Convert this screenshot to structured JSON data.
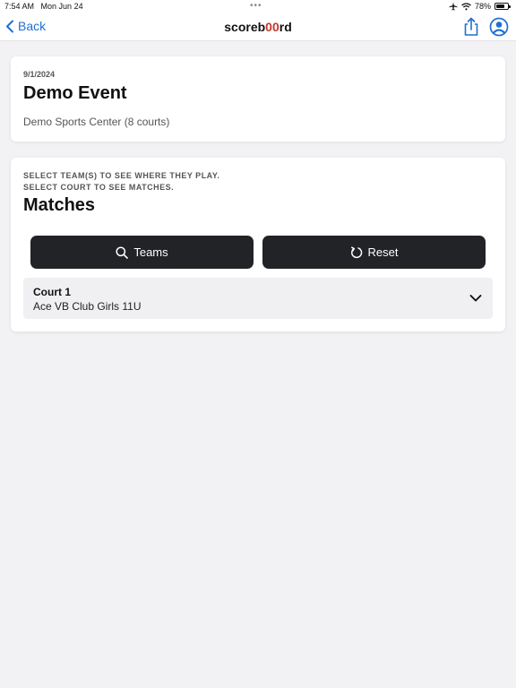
{
  "status_bar": {
    "time": "7:54 AM",
    "date": "Mon Jun 24",
    "battery": "78%",
    "battery_level": 0.78,
    "more_dots": "•••"
  },
  "nav": {
    "back_label": "Back",
    "title_prefix": "scoreb",
    "title_accent": "00",
    "title_suffix": "rd",
    "accent_color": "#c0392b",
    "link_color": "#1f6fd1"
  },
  "event": {
    "date": "9/1/2024",
    "title": "Demo Event",
    "venue": "Demo Sports Center (8 courts)"
  },
  "matches": {
    "instruction_line1": "SELECT TEAM(S) TO SEE WHERE THEY PLAY.",
    "instruction_line2": "SELECT COURT TO SEE MATCHES.",
    "title": "Matches",
    "teams_button": "Teams",
    "reset_button": "Reset",
    "courts": [
      {
        "name": "Court 1",
        "team": "Ace VB Club Girls 11U"
      }
    ]
  },
  "icons": {
    "back": "chevron-left-icon",
    "share": "share-icon",
    "account": "user-circle-icon",
    "search": "search-icon",
    "reset": "refresh-icon",
    "expand": "chevron-down-icon"
  }
}
